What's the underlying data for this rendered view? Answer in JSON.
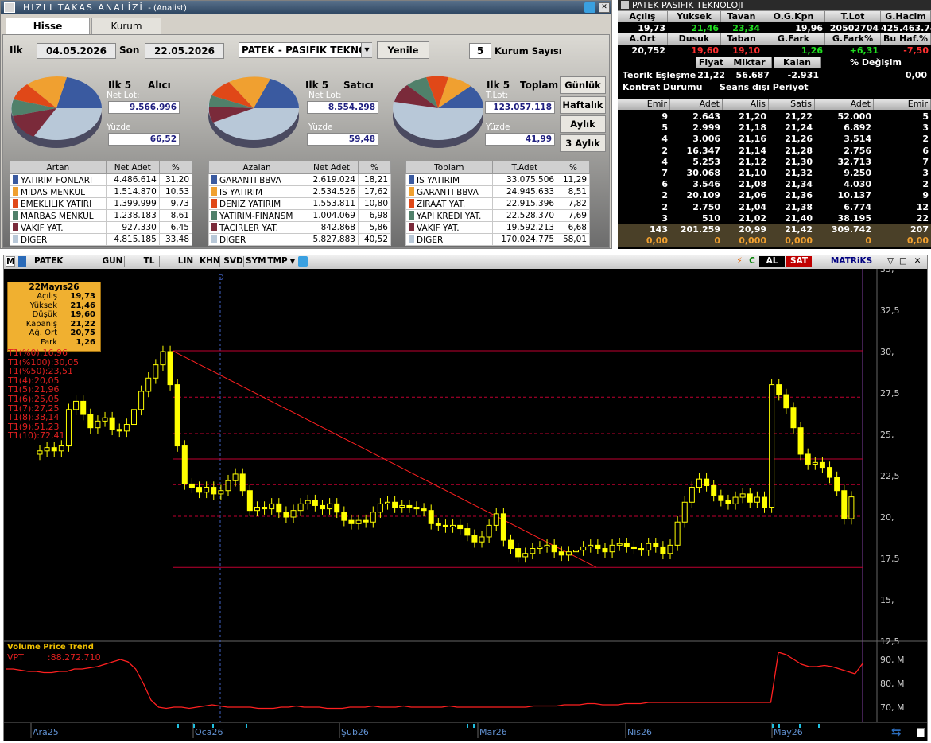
{
  "window": {
    "title": "HIZLI TAKAS ANALİZİ",
    "subtitle": "- (Analist)"
  },
  "tabs": [
    "Hisse",
    "Kurum"
  ],
  "filters": {
    "ilk_label": "Ilk",
    "start_date": "04.05.2026",
    "son_label": "Son",
    "end_date": "22.05.2026",
    "stock": "PATEK - PASIFIK TEKNO",
    "refresh": "Yenile",
    "kurum_count": "5",
    "kurum_label": "Kurum Sayısı"
  },
  "period_buttons": [
    "Günlük",
    "Haftalık",
    "Aylık",
    "3 Aylık"
  ],
  "pies": [
    {
      "title": "Ilk 5",
      "kind": "Alıcı",
      "lot_label": "Net Lot:",
      "lot": "9.566.996",
      "pct_label": "Yüzde",
      "pct": "66,52"
    },
    {
      "title": "Ilk 5",
      "kind": "Satıcı",
      "lot_label": "Net Lot:",
      "lot": "8.554.298",
      "pct_label": "Yüzde",
      "pct": "59,48"
    },
    {
      "title": "Ilk 5",
      "kind": "Toplam",
      "lot_label": "T.Lot:",
      "lot": "123.057.118",
      "pct_label": "Yüzde",
      "pct": "41,99"
    }
  ],
  "tables": [
    {
      "headers": [
        "Artan",
        "Net Adet",
        "%"
      ],
      "rows": [
        [
          "YATIRIM FONLARI",
          "4.486.614",
          "31,20"
        ],
        [
          "MIDAS MENKUL",
          "1.514.870",
          "10,53"
        ],
        [
          "EMEKLILIK YATIRI",
          "1.399.999",
          "9,73"
        ],
        [
          "MARBAS MENKUL",
          "1.238.183",
          "8,61"
        ],
        [
          "VAKIF YAT.",
          "927.330",
          "6,45"
        ],
        [
          "DIGER",
          "4.815.185",
          "33,48"
        ]
      ]
    },
    {
      "headers": [
        "Azalan",
        "Net Adet",
        "%"
      ],
      "rows": [
        [
          "GARANTI BBVA",
          "2.619.024",
          "18,21"
        ],
        [
          "IS YATIRIM",
          "2.534.526",
          "17,62"
        ],
        [
          "DENIZ YATIRIM",
          "1.553.811",
          "10,80"
        ],
        [
          "YATIRIM-FINANSM",
          "1.004.069",
          "6,98"
        ],
        [
          "TACIRLER YAT.",
          "842.868",
          "5,86"
        ],
        [
          "DIGER",
          "5.827.883",
          "40,52"
        ]
      ]
    },
    {
      "headers": [
        "Toplam",
        "T.Adet",
        "%"
      ],
      "rows": [
        [
          "IS YATIRIM",
          "33.075.506",
          "11,29"
        ],
        [
          "GARANTI BBVA",
          "24.945.633",
          "8,51"
        ],
        [
          "ZIRAAT YAT.",
          "22.915.396",
          "7,82"
        ],
        [
          "YAPI KREDI YAT.",
          "22.528.370",
          "7,69"
        ],
        [
          "VAKIF YAT.",
          "19.592.213",
          "6,68"
        ],
        [
          "DIGER",
          "170.024.775",
          "58,01"
        ]
      ]
    }
  ],
  "swatch_colors": [
    "#3a5aa0",
    "#f0a030",
    "#e04818",
    "#50806a",
    "#7a2a3a",
    "#b8c8d8"
  ],
  "quote": {
    "title": "PATEK   PASIFIK TEKNOLOJI",
    "h1": [
      "Açılış",
      "Yuksek",
      "Tavan",
      "O.G.Kpn",
      "T.Lot",
      "G.Hacim"
    ],
    "v1": [
      "19,73",
      "21,46",
      "23,34",
      "19,96",
      "20502704",
      "425.463.740"
    ],
    "h2": [
      "A.Ort",
      "Dusuk",
      "Taban",
      "G.Fark",
      "G.Fark%",
      "Bu Haf.%"
    ],
    "v2": [
      "20,752",
      "19,60",
      "19,10",
      "1,26",
      "+6,31",
      "-7,50"
    ],
    "th": [
      "Fiyat",
      "Miktar",
      "Kalan Mik.",
      "% Değişim"
    ],
    "teorik": [
      "Teorik Eşleşme",
      "21,22",
      "56.687",
      "-2.931",
      "0,00"
    ],
    "kontrat": [
      "Kontrat Durumu",
      "Seans dışı Periyot"
    ]
  },
  "depth": {
    "headers": [
      "Emir",
      "Adet",
      "Alis",
      "Satis",
      "Adet",
      "Emir"
    ],
    "rows": [
      [
        "9",
        "2.643",
        "21,20",
        "21,22",
        "52.000",
        "5"
      ],
      [
        "5",
        "2.999",
        "21,18",
        "21,24",
        "6.892",
        "3"
      ],
      [
        "4",
        "3.006",
        "21,16",
        "21,26",
        "3.514",
        "2"
      ],
      [
        "2",
        "16.347",
        "21,14",
        "21,28",
        "2.756",
        "6"
      ],
      [
        "4",
        "5.253",
        "21,12",
        "21,30",
        "32.713",
        "7"
      ],
      [
        "7",
        "30.068",
        "21,10",
        "21,32",
        "9.250",
        "3"
      ],
      [
        "6",
        "3.546",
        "21,08",
        "21,34",
        "4.030",
        "2"
      ],
      [
        "2",
        "20.109",
        "21,06",
        "21,36",
        "10.137",
        "9"
      ],
      [
        "2",
        "2.750",
        "21,04",
        "21,38",
        "6.774",
        "12"
      ],
      [
        "3",
        "510",
        "21,02",
        "21,40",
        "38.195",
        "22"
      ]
    ],
    "total": [
      "143",
      "201.259",
      "20,99",
      "21,42",
      "309.742",
      "207"
    ],
    "zero": [
      "0,00",
      "0",
      "0,000",
      "0,000",
      "0",
      "0,00"
    ]
  },
  "chart_toolbar": {
    "symbol": "PATEK",
    "items": [
      "GUN",
      "TL",
      "LIN",
      "KHN",
      "SVD",
      "SYM",
      "TMP"
    ],
    "al": "AL",
    "sat": "SAT",
    "brand": "MATRiKS"
  },
  "ohlc_box": {
    "date": "22Mayıs26",
    "labels": [
      "Açılış",
      "Yüksek",
      "Düşük",
      "Kapanış",
      "Ağ. Ort",
      "Fark"
    ],
    "values": [
      "19,73",
      "21,46",
      "19,60",
      "21,22",
      "20,75",
      "1,26"
    ]
  },
  "fib_labels": [
    "T1(%0):16,96",
    "T1(%100):30,05",
    "T1(%50):23,51",
    "T1(4):20,05",
    "T1(5):21,96",
    "T1(6):25,05",
    "T1(7):27,25",
    "T1(8):38,14",
    "T1(9):51,23",
    "T1(10):72,41"
  ],
  "marker_d": "D",
  "y_ticks": [
    "35,",
    "32,5",
    "30,",
    "27,5",
    "25,",
    "22,5",
    "20,",
    "17,5",
    "15,",
    "12,5"
  ],
  "vpt": {
    "title": "Volume Price Trend",
    "label": "VPT",
    "value": ":88.272.710",
    "ticks": [
      "90, M",
      "80, M",
      "70, M"
    ]
  },
  "x_labels": [
    "Ara25",
    "Oca26",
    "Şub26",
    "Mar26",
    "Nis26",
    "May26"
  ],
  "colors": {
    "up": "#000000",
    "down": "#ffff00",
    "wick": "#ffff00",
    "vpt": "#ff2020",
    "hline": "#c00030",
    "trend": "#ff2020",
    "grid_dash": "#c00030"
  },
  "chart_data": {
    "type": "candlestick",
    "ylim": [
      12.5,
      35
    ],
    "y_ticks": [
      12.5,
      15,
      17.5,
      20,
      22.5,
      25,
      27.5,
      30,
      32.5,
      35
    ],
    "x_labels": [
      "Ara25",
      "Oca26",
      "Şub26",
      "Mar26",
      "Nis26",
      "May26"
    ],
    "hlines_solid": [
      16.96,
      23.51,
      30.05
    ],
    "hlines_dashed": [
      20.05,
      21.96,
      25.05,
      27.25
    ],
    "trendline": [
      [
        0,
        30.05
      ],
      [
        1,
        16.96
      ]
    ],
    "closes": [
      24.0,
      24.2,
      24.0,
      24.3,
      26.5,
      27.0,
      26.2,
      25.4,
      25.8,
      26.0,
      25.3,
      25.2,
      25.6,
      26.5,
      27.6,
      28.4,
      29.2,
      30.0,
      28.0,
      24.3,
      22.0,
      21.8,
      21.5,
      21.8,
      21.4,
      21.6,
      22.2,
      22.6,
      21.6,
      20.4,
      20.6,
      20.5,
      20.8,
      20.3,
      20.0,
      20.4,
      20.8,
      21.0,
      20.7,
      20.5,
      20.8,
      20.3,
      19.8,
      19.6,
      19.8,
      19.7,
      20.3,
      20.8,
      20.9,
      20.6,
      20.7,
      20.6,
      20.5,
      20.4,
      19.6,
      19.5,
      19.4,
      19.5,
      19.3,
      18.9,
      18.5,
      18.8,
      19.5,
      20.2,
      18.6,
      18.1,
      17.6,
      17.8,
      18.1,
      18.2,
      18.3,
      17.9,
      17.7,
      17.9,
      18.0,
      18.2,
      18.3,
      18.1,
      17.9,
      18.3,
      18.4,
      18.2,
      18.1,
      18.0,
      18.4,
      18.2,
      17.8,
      18.3,
      19.7,
      20.9,
      21.8,
      22.3,
      21.9,
      21.3,
      21.0,
      20.8,
      21.2,
      21.4,
      20.9,
      21.2,
      20.6,
      28.0,
      27.4,
      26.6,
      25.4,
      23.8,
      23.2,
      23.3,
      23.0,
      22.4,
      21.6,
      19.9,
      21.22
    ],
    "vpt": [
      86,
      86,
      85.5,
      85,
      85,
      84.5,
      84.5,
      85,
      85,
      86,
      86,
      86.5,
      87,
      88,
      89,
      90,
      89,
      86,
      80,
      73,
      70,
      69.5,
      70,
      70,
      69.5,
      70,
      70.5,
      71,
      70.5,
      70,
      70,
      70,
      70,
      69.5,
      69.5,
      69.5,
      70,
      70,
      70.5,
      70,
      70,
      70,
      69.5,
      69.5,
      69.5,
      70,
      70,
      70,
      70.5,
      70,
      70,
      70,
      70.5,
      70,
      70,
      70,
      70,
      70,
      70.5,
      70,
      70,
      70,
      70,
      70,
      70,
      70,
      70,
      70,
      70,
      70.5,
      70.5,
      70.5,
      70.5,
      71,
      71,
      71,
      71.5,
      71.5,
      71,
      71,
      71,
      71.5,
      71.5,
      71.5,
      72,
      72,
      72,
      72,
      72,
      72,
      72,
      72,
      72,
      72,
      72,
      72,
      72,
      72,
      72,
      72,
      72,
      93,
      92,
      90,
      88,
      87,
      87,
      87.5,
      87,
      86,
      85,
      84,
      88.27
    ],
    "vpt_ylim": [
      65,
      95
    ]
  }
}
